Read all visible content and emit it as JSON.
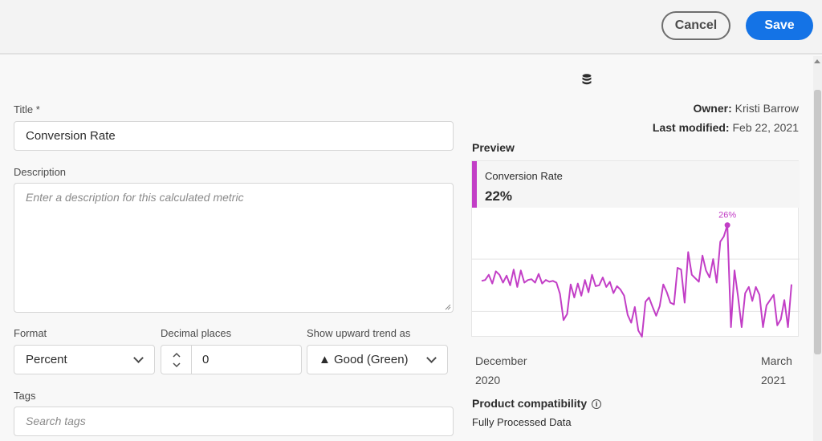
{
  "topbar": {
    "cancel_label": "Cancel",
    "save_label": "Save"
  },
  "form": {
    "title_label": "Title",
    "title_required": "*",
    "title_value": "Conversion Rate",
    "description_label": "Description",
    "description_placeholder": "Enter a description for this calculated metric",
    "format_label": "Format",
    "format_value": "Percent",
    "decimal_label": "Decimal places",
    "decimal_value": "0",
    "trend_label": "Show upward trend as",
    "trend_value": "▲ Good (Green)",
    "tags_label": "Tags",
    "tags_placeholder": "Search tags"
  },
  "meta": {
    "owner_label": "Owner:",
    "owner_value": "Kristi Barrow",
    "modified_label": "Last modified:",
    "modified_value": "Feb 22, 2021"
  },
  "preview": {
    "section_title": "Preview",
    "metric_name": "Conversion Rate",
    "metric_value": "22%",
    "peak_label": "26%",
    "accent_color": "#c23ec6"
  },
  "chart_data": {
    "type": "line",
    "x_tick_labels": [
      [
        "December",
        "2020"
      ],
      [
        "March",
        "2021"
      ]
    ],
    "series": [
      {
        "values": [
          19.5,
          19.6,
          20.2,
          19.2,
          20.6,
          20.2,
          19.3,
          20.1,
          19.0,
          20.8,
          18.8,
          20.7,
          19.3,
          19.6,
          19.7,
          19.3,
          20.3,
          19.2,
          19.6,
          19.4,
          19.5,
          19.3,
          18.0,
          15.0,
          15.7,
          19.1,
          17.6,
          19.2,
          17.8,
          19.6,
          18.2,
          20.2,
          18.9,
          19.0,
          19.9,
          18.8,
          19.4,
          18.1,
          18.9,
          18.5,
          17.8,
          15.6,
          14.7,
          16.5,
          13.8,
          13.1,
          17.1,
          17.6,
          16.5,
          15.5,
          16.6,
          19.1,
          18.2,
          17.0,
          16.8,
          21.0,
          20.8,
          17.0,
          22.8,
          20.2,
          19.8,
          19.4,
          22.4,
          20.7,
          19.9,
          22.0,
          19.3,
          24.0,
          24.6,
          25.9,
          14.2,
          20.7,
          17.7,
          14.2,
          18.1,
          18.8,
          17.2,
          18.8,
          17.9,
          14.2,
          16.7,
          17.3,
          17.9,
          14.4,
          15.1,
          17.3,
          14.2,
          19.1
        ]
      }
    ],
    "ylim": [
      13.0,
      27.9
    ],
    "grid": true,
    "peak_index": 69
  }
}
